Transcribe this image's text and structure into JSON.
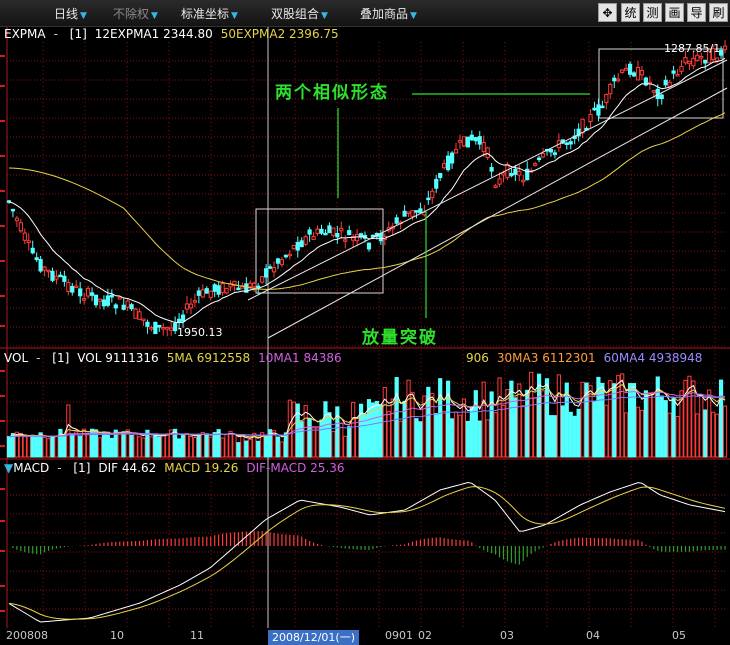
{
  "toolbar": {
    "menus": [
      {
        "label": "日线",
        "dim": false
      },
      {
        "label": "不除权",
        "dim": true
      },
      {
        "label": "标准坐标",
        "dim": false
      },
      {
        "label": "双股组合",
        "dim": false
      },
      {
        "label": "叠加商品",
        "dim": false
      }
    ],
    "buttons": [
      "统",
      "测",
      "画",
      "导",
      "刷"
    ]
  },
  "price_panel": {
    "name": "EXPMA",
    "param": "[1]",
    "line1": "12EXPMA1 2344.80",
    "line2": "50EXPMA2 2396.75",
    "low_label": "1950.13",
    "high_label": "1287.85/1"
  },
  "volume_panel": {
    "name": "VOL",
    "param": "[1]",
    "vol": "VOL 9111316",
    "ma1": "5MA 6912558",
    "ma2": "10MA1 84386",
    "ma2_tail": "906",
    "ma3": "30MA3 6112301",
    "ma4": "60MA4 4938948"
  },
  "macd_panel": {
    "name": "MACD",
    "param": "[1]",
    "dif": "DIF 44.62",
    "macd": "MACD 19.26",
    "diff": "DIF-MACD 25.36"
  },
  "annotations": {
    "pattern": "两个相似形态",
    "breakout": "放量突破"
  },
  "dates": [
    "200808",
    "10",
    "11",
    "0901",
    "02",
    "03",
    "04",
    "05"
  ],
  "cursor_date": "2008/12/01(一)",
  "colors": {
    "up": "#ff3b3b",
    "down": "#54ffff",
    "ma_short": "#ffffff",
    "ma_long": "#e6d34a",
    "annotation": "#2ee02e",
    "macd_down": "#2f9d2f",
    "diff": "#d060e0"
  },
  "chart_data": {
    "type": "candlestick",
    "series": [
      {
        "name": "12EXPMA1"
      },
      {
        "name": "50EXPMA2"
      },
      {
        "name": "VOL"
      },
      {
        "name": "DIF"
      },
      {
        "name": "MACD"
      }
    ],
    "x_categories": [
      "200808",
      "10",
      "11",
      "0901",
      "02",
      "03",
      "04",
      "05"
    ]
  }
}
